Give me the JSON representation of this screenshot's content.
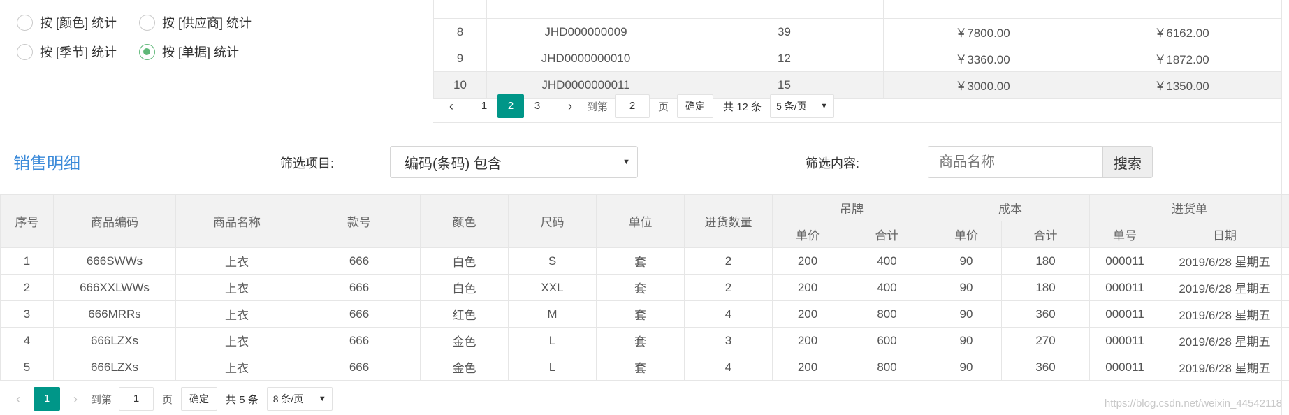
{
  "radios": [
    {
      "label": "按 [颜色] 统计",
      "checked": false
    },
    {
      "label": "按 [供应商] 统计",
      "checked": false
    },
    {
      "label": "按 [季节] 统计",
      "checked": false
    },
    {
      "label": "按 [单据] 统计",
      "checked": true
    }
  ],
  "top_table": {
    "rows": [
      [
        "8",
        "JHD000000009",
        "39",
        "￥7800.00",
        "￥6162.00"
      ],
      [
        "9",
        "JHD0000000010",
        "12",
        "￥3360.00",
        "￥1872.00"
      ],
      [
        "10",
        "JHD0000000011",
        "15",
        "￥3000.00",
        "￥1350.00"
      ]
    ]
  },
  "top_pager": {
    "prev": "‹",
    "next": "›",
    "pages": [
      "1",
      "2",
      "3"
    ],
    "current": "2",
    "goto_prefix": "到第",
    "goto_value": "2",
    "goto_suffix": "页",
    "confirm": "确定",
    "total": "共 12 条",
    "page_size": "5 条/页"
  },
  "section": {
    "title": "销售明细",
    "filter_item_label": "筛选项目:",
    "filter_item_value": "编码(条码) 包含",
    "filter_content_label": "筛选内容:",
    "search_placeholder": "商品名称",
    "search_button": "搜索"
  },
  "main_table": {
    "headers": {
      "seq": "序号",
      "code": "商品编码",
      "name": "商品名称",
      "style": "款号",
      "color": "颜色",
      "size": "尺码",
      "unit": "单位",
      "qty": "进货数量",
      "tag": "吊牌",
      "cost": "成本",
      "order": "进货单",
      "unit_price": "单价",
      "total": "合计",
      "order_no": "单号",
      "date": "日期"
    },
    "rows": [
      [
        "1",
        "666SWWs",
        "上衣",
        "666",
        "白色",
        "S",
        "套",
        "2",
        "200",
        "400",
        "90",
        "180",
        "000011",
        "2019/6/28 星期五"
      ],
      [
        "2",
        "666XXLWWs",
        "上衣",
        "666",
        "白色",
        "XXL",
        "套",
        "2",
        "200",
        "400",
        "90",
        "180",
        "000011",
        "2019/6/28 星期五"
      ],
      [
        "3",
        "666MRRs",
        "上衣",
        "666",
        "红色",
        "M",
        "套",
        "4",
        "200",
        "800",
        "90",
        "360",
        "000011",
        "2019/6/28 星期五"
      ],
      [
        "4",
        "666LZXs",
        "上衣",
        "666",
        "金色",
        "L",
        "套",
        "3",
        "200",
        "600",
        "90",
        "270",
        "000011",
        "2019/6/28 星期五"
      ],
      [
        "5",
        "666LZXs",
        "上衣",
        "666",
        "金色",
        "L",
        "套",
        "4",
        "200",
        "800",
        "90",
        "360",
        "000011",
        "2019/6/28 星期五"
      ]
    ]
  },
  "bottom_pager": {
    "prev": "‹",
    "next": "›",
    "current": "1",
    "goto_prefix": "到第",
    "goto_value": "1",
    "goto_suffix": "页",
    "confirm": "确定",
    "total": "共 5 条",
    "page_size": "8 条/页"
  },
  "watermark": "https://blog.csdn.net/weixin_44542118",
  "colors": {
    "accent": "#009688",
    "radio_checked": "#5FB878",
    "title": "#3b8ad9"
  }
}
